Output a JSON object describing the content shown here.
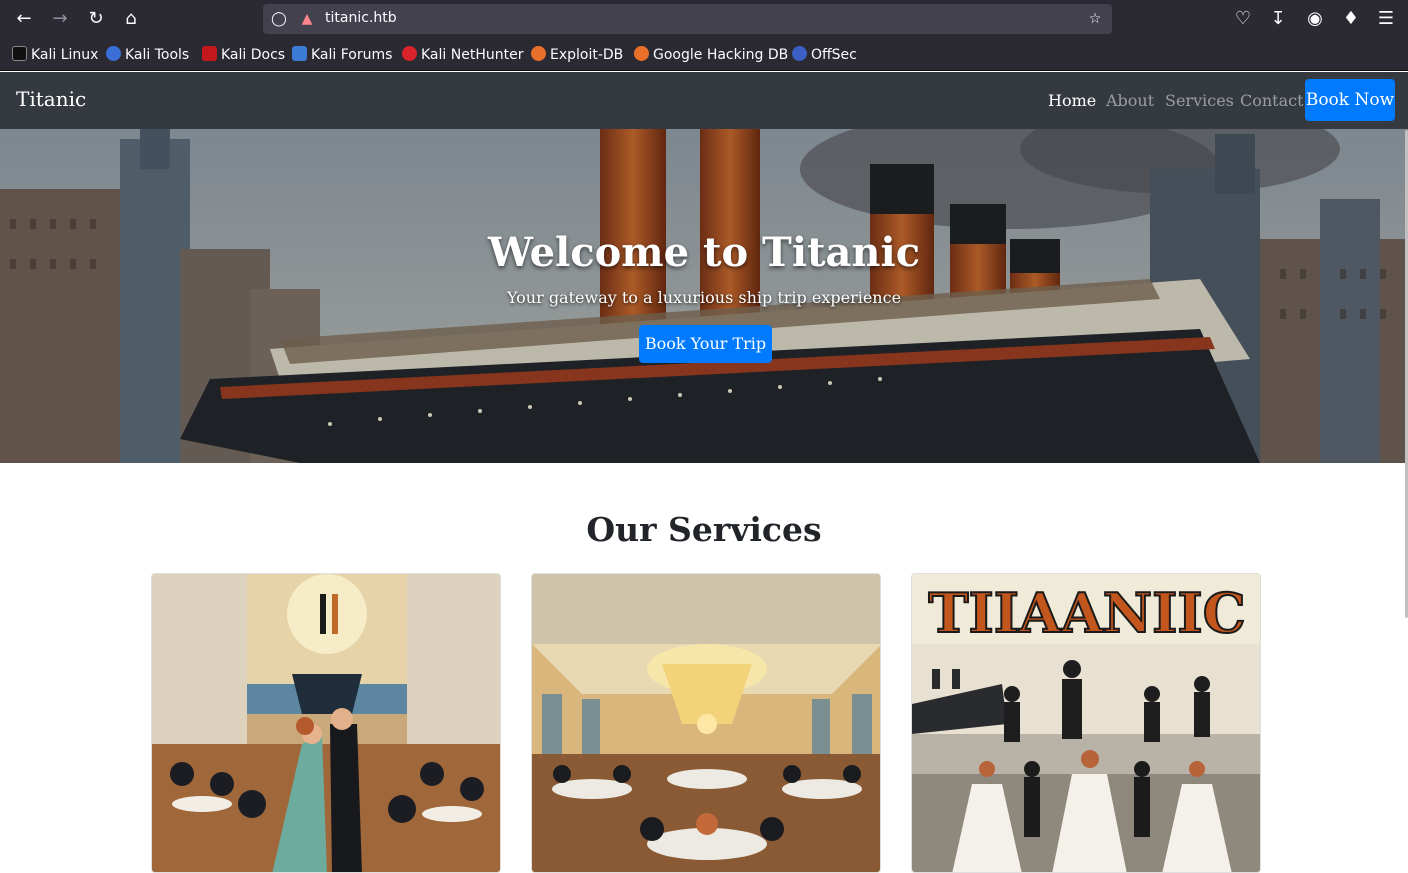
{
  "browser": {
    "url": "titanic.htb",
    "bookmarks": [
      "Kali Linux",
      "Kali Tools",
      "Kali Docs",
      "Kali Forums",
      "Kali NetHunter",
      "Exploit-DB",
      "Google Hacking DB",
      "OffSec"
    ]
  },
  "site": {
    "brand": "Titanic",
    "nav": [
      "Home",
      "About",
      "Services",
      "Contact"
    ],
    "book_now": "Book Now"
  },
  "hero": {
    "title": "Welcome to Titanic",
    "subtitle": "Your gateway to a luxurious ship trip experience",
    "button": "Book Your Trip"
  },
  "services": {
    "title": "Our Services",
    "card3_poster_text": "TIIAANIIC"
  },
  "colors": {
    "accent": "#007bff",
    "navbar": "#343a40",
    "chrome": "#2b2a33"
  }
}
